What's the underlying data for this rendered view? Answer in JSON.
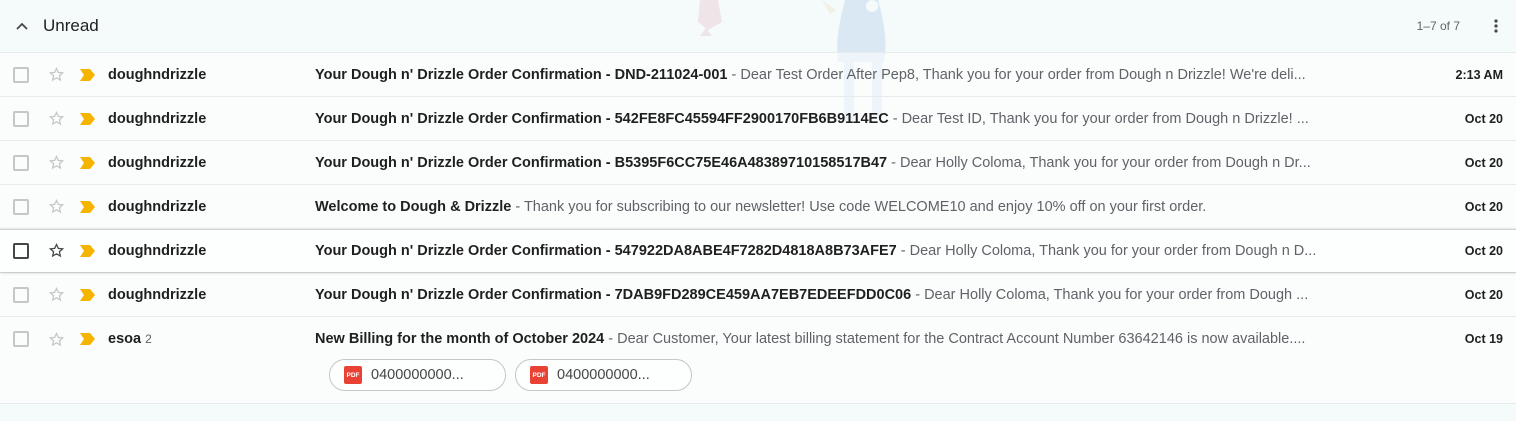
{
  "section": {
    "title": "Unread",
    "pager": "1–7 of 7"
  },
  "emails": [
    {
      "sender": "doughndrizzle",
      "count": "",
      "subject": "Your Dough n' Drizzle Order Confirmation - DND-211024-001",
      "separator": " - ",
      "snippet": "Dear Test Order After Pep8, Thank you for your order from Dough n Drizzle! We're deli...",
      "date": "2:13 AM"
    },
    {
      "sender": "doughndrizzle",
      "count": "",
      "subject": "Your Dough n' Drizzle Order Confirmation - 542FE8FC45594FF2900170FB6B9114EC",
      "separator": " - ",
      "snippet": "Dear Test ID, Thank you for your order from Dough n Drizzle! ...",
      "date": "Oct 20"
    },
    {
      "sender": "doughndrizzle",
      "count": "",
      "subject": "Your Dough n' Drizzle Order Confirmation - B5395F6CC75E46A48389710158517B47",
      "separator": " - ",
      "snippet": "Dear Holly Coloma, Thank you for your order from Dough n Dr...",
      "date": "Oct 20"
    },
    {
      "sender": "doughndrizzle",
      "count": "",
      "subject": "Welcome to Dough & Drizzle",
      "separator": " - ",
      "snippet": "Thank you for subscribing to our newsletter! Use code WELCOME10 and enjoy 10% off on your first order.",
      "date": "Oct 20"
    },
    {
      "sender": "doughndrizzle",
      "count": "",
      "subject": "Your Dough n' Drizzle Order Confirmation - 547922DA8ABE4F7282D4818A8B73AFE7",
      "separator": " - ",
      "snippet": "Dear Holly Coloma, Thank you for your order from Dough n D...",
      "date": "Oct 20"
    },
    {
      "sender": "doughndrizzle",
      "count": "",
      "subject": "Your Dough n' Drizzle Order Confirmation - 7DAB9FD289CE459AA7EB7EDEEFDD0C06",
      "separator": " - ",
      "snippet": "Dear Holly Coloma, Thank you for your order from Dough ...",
      "date": "Oct 20"
    },
    {
      "sender": "esoa",
      "count": "2",
      "subject": "New Billing for the month of October 2024",
      "separator": " - ",
      "snippet": "Dear Customer, Your latest billing statement for the Contract Account Number 63642146 is now available....",
      "date": "Oct 19",
      "attachments": [
        {
          "icon": "pdf-icon",
          "label": "0400000000..."
        },
        {
          "icon": "pdf-icon",
          "label": "0400000000..."
        }
      ]
    }
  ],
  "colors": {
    "important_marker": "#f4b400",
    "pdf_icon": "#e94235"
  },
  "icons": {
    "collapse": "chevron-up-icon",
    "more": "more-vert-icon",
    "checkbox": "checkbox-icon",
    "star": "star-icon",
    "important": "important-marker-icon"
  }
}
